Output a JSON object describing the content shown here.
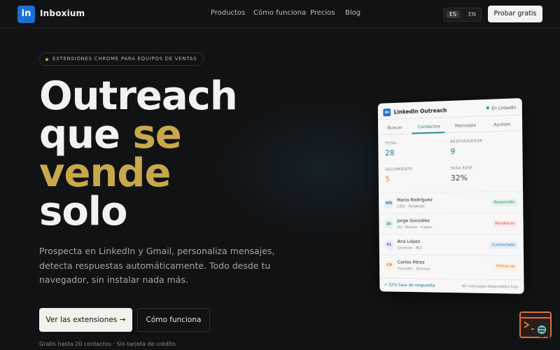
{
  "nav": {
    "logo_letter": "in",
    "brand": "Inboxium",
    "links": [
      "Productos",
      "Cómo funciona",
      "Precios",
      "Blog"
    ],
    "lang_active": "ES",
    "lang_other": "EN",
    "cta": "Probar gratis"
  },
  "hero": {
    "pill": "EXTENSIONES CHROME PARA EQUIPOS DE VENTAS",
    "line1": "Outreach",
    "line2_white": "que ",
    "line2_gold": "se",
    "line3": "vende",
    "line4": "solo",
    "subtitle": "Prospecta en LinkedIn y Gmail, personaliza mensajes, detecta respuestas automáticamente. Todo desde tu navegador, sin instalar nada más.",
    "primary_button": "Ver las extensiones →",
    "secondary_button": "Cómo funciona",
    "note": "Gratis hasta 20 contactos · Sin tarjeta de crédito"
  },
  "card": {
    "icon_letter": "in",
    "title": "LinkedIn Outreach",
    "status": "En LinkedIn",
    "tabs": [
      "Buscar",
      "Contactos",
      "Mensajes",
      "Ajustes"
    ],
    "stats": [
      {
        "label": "TOTAL",
        "value": "28",
        "color": "#1f7a86"
      },
      {
        "label": "RESPONDIERON",
        "value": "9",
        "color": "#1f7a86"
      },
      {
        "label": "SEGUIMIENTO",
        "value": "5",
        "color": "#d9822b"
      },
      {
        "label": "TASA RESP.",
        "value": "32%",
        "color": "#444444"
      }
    ],
    "contacts": [
      {
        "initials": "MR",
        "name": "María Rodríguez",
        "role": "CEO · Falabella",
        "badge": "Respondió",
        "badge_bg": "#e3f4e9",
        "badge_fg": "#2e8b57",
        "av_bg": "#e6eef8",
        "av_fg": "#3a6ea5"
      },
      {
        "initials": "JG",
        "name": "Jorge González",
        "role": "Dir. Ventas · Copec",
        "badge": "Pendiente",
        "badge_bg": "#fdecec",
        "badge_fg": "#c0504d",
        "av_bg": "#e3f4e9",
        "av_fg": "#2e8b57"
      },
      {
        "initials": "AL",
        "name": "Ana López",
        "role": "Gerente · BCI",
        "badge": "Contactado",
        "badge_bg": "#e6eef8",
        "badge_fg": "#3a6ea5",
        "av_bg": "#ece8f7",
        "av_fg": "#6a5acd"
      },
      {
        "initials": "CP",
        "name": "Carlos Pérez",
        "role": "Founder · Startup",
        "badge": "Follow-up",
        "badge_bg": "#fdf1e2",
        "badge_fg": "#c77a1f",
        "av_bg": "#fdf1e2",
        "av_fg": "#c77a1f"
      }
    ],
    "footer_left": "↗ 32% tasa de respuesta",
    "footer_right": "40 mensajes disponibles hoy"
  },
  "colors": {
    "background": "#111213",
    "gold": "#c9a84c",
    "brand_blue": "#1a6fd1",
    "teal": "#1f7a86"
  },
  "widget_icon": "terminal-search-icon"
}
